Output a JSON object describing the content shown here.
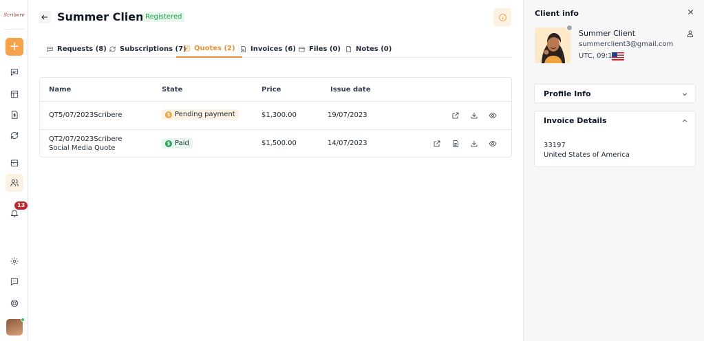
{
  "app": {
    "logo_text": "Scribere"
  },
  "rail": {
    "notifications_count": "13"
  },
  "header": {
    "title": "Summer Client",
    "status_badge": "Registered"
  },
  "tabs": [
    {
      "label": "Requests (8)",
      "icon": "chat-icon"
    },
    {
      "label": "Subscriptions (7)",
      "icon": "refresh-icon"
    },
    {
      "label": "Quotes (2)",
      "icon": "quote-icon",
      "active": true
    },
    {
      "label": "Invoices (6)",
      "icon": "invoice-icon"
    },
    {
      "label": "Files (0)",
      "icon": "folder-icon"
    },
    {
      "label": "Notes (0)",
      "icon": "note-icon"
    }
  ],
  "table": {
    "columns": [
      "Name",
      "State",
      "Price",
      "Issue date"
    ],
    "rows": [
      {
        "name_line1": "QT5/07/2023Scribere",
        "name_line2": "",
        "state": "Pending payment",
        "state_icon": "$",
        "price": "$1,300.00",
        "issue_date": "19/07/2023"
      },
      {
        "name_line1": "QT2/07/2023Scribere",
        "name_line2": "Social Media Quote",
        "state": "Paid",
        "state_icon": "$",
        "price": "$1,500.00",
        "issue_date": "14/07/2023"
      }
    ]
  },
  "client_panel": {
    "title": "Client info",
    "name": "Summer Client",
    "email": "summerclient3@gmail.com",
    "timezone": "UTC, 09:13",
    "profile_section": "Profile Info",
    "invoice_section": "Invoice Details",
    "invoice_line1": "33197",
    "invoice_line2": "United States of America"
  },
  "colors": {
    "accent": "#e8932f",
    "accent_bg": "#fdf1e3",
    "registered_green": "#16a34a",
    "paid_green": "#22a55a",
    "notification_red": "#c0262d"
  }
}
